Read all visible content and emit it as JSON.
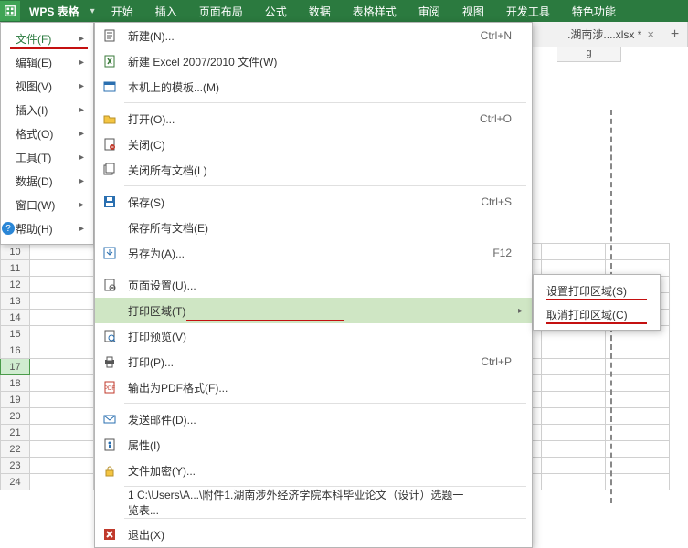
{
  "app": {
    "name": "WPS 表格",
    "caret": "▾"
  },
  "ribbon_tabs": [
    "开始",
    "插入",
    "页面布局",
    "公式",
    "数据",
    "表格样式",
    "审阅",
    "视图",
    "开发工具",
    "特色功能"
  ],
  "doc_tab": {
    "label": ".湖南涉....xlsx *",
    "close": "×",
    "plus": "+"
  },
  "sidemenu": [
    {
      "label": "文件(F)",
      "active": true,
      "underline": true
    },
    {
      "label": "编辑(E)"
    },
    {
      "label": "视图(V)"
    },
    {
      "label": "插入(I)"
    },
    {
      "label": "格式(O)"
    },
    {
      "label": "工具(T)"
    },
    {
      "label": "数据(D)"
    },
    {
      "label": "窗口(W)"
    },
    {
      "label": "帮助(H)",
      "help_icon": "?"
    }
  ],
  "filemenu": [
    {
      "icon": "doc-new",
      "label": "新建(N)...",
      "shortcut": "Ctrl+N"
    },
    {
      "icon": "doc-excel",
      "label": "新建 Excel 2007/2010 文件(W)"
    },
    {
      "icon": "template",
      "label": "本机上的模板...(M)"
    },
    {
      "sep": true
    },
    {
      "icon": "open",
      "label": "打开(O)...",
      "shortcut": "Ctrl+O"
    },
    {
      "icon": "close",
      "label": "关闭(C)"
    },
    {
      "icon": "close-all",
      "label": "关闭所有文档(L)"
    },
    {
      "sep": true
    },
    {
      "icon": "save",
      "label": "保存(S)",
      "shortcut": "Ctrl+S"
    },
    {
      "icon": "",
      "label": "保存所有文档(E)"
    },
    {
      "icon": "saveas",
      "label": "另存为(A)...",
      "shortcut": "F12"
    },
    {
      "sep": true
    },
    {
      "icon": "pagesetup",
      "label": "页面设置(U)..."
    },
    {
      "icon": "",
      "label": "打印区域(T)",
      "sub": true,
      "hover": true,
      "underline": true
    },
    {
      "icon": "preview",
      "label": "打印预览(V)"
    },
    {
      "icon": "print",
      "label": "打印(P)...",
      "shortcut": "Ctrl+P"
    },
    {
      "icon": "pdf",
      "label": "输出为PDF格式(F)..."
    },
    {
      "sep": true
    },
    {
      "icon": "mail",
      "label": "发送邮件(D)..."
    },
    {
      "icon": "props",
      "label": "属性(I)"
    },
    {
      "icon": "lock",
      "label": "文件加密(Y)..."
    },
    {
      "sep": true
    },
    {
      "icon": "",
      "label": "1 C:\\Users\\A...\\附件1.湖南涉外经济学院本科毕业论文（设计）选题一览表..."
    },
    {
      "sep": true
    },
    {
      "icon": "exit",
      "label": "退出(X)"
    }
  ],
  "submenu": [
    {
      "label": "设置打印区域(S)"
    },
    {
      "label": "取消打印区域(C)"
    }
  ],
  "row_headers": [
    "10",
    "11",
    "12",
    "13",
    "14",
    "15",
    "16",
    "17",
    "18",
    "19",
    "20",
    "21",
    "22",
    "23",
    "24"
  ],
  "selected_row": "17",
  "col_header_cutoff": "g"
}
